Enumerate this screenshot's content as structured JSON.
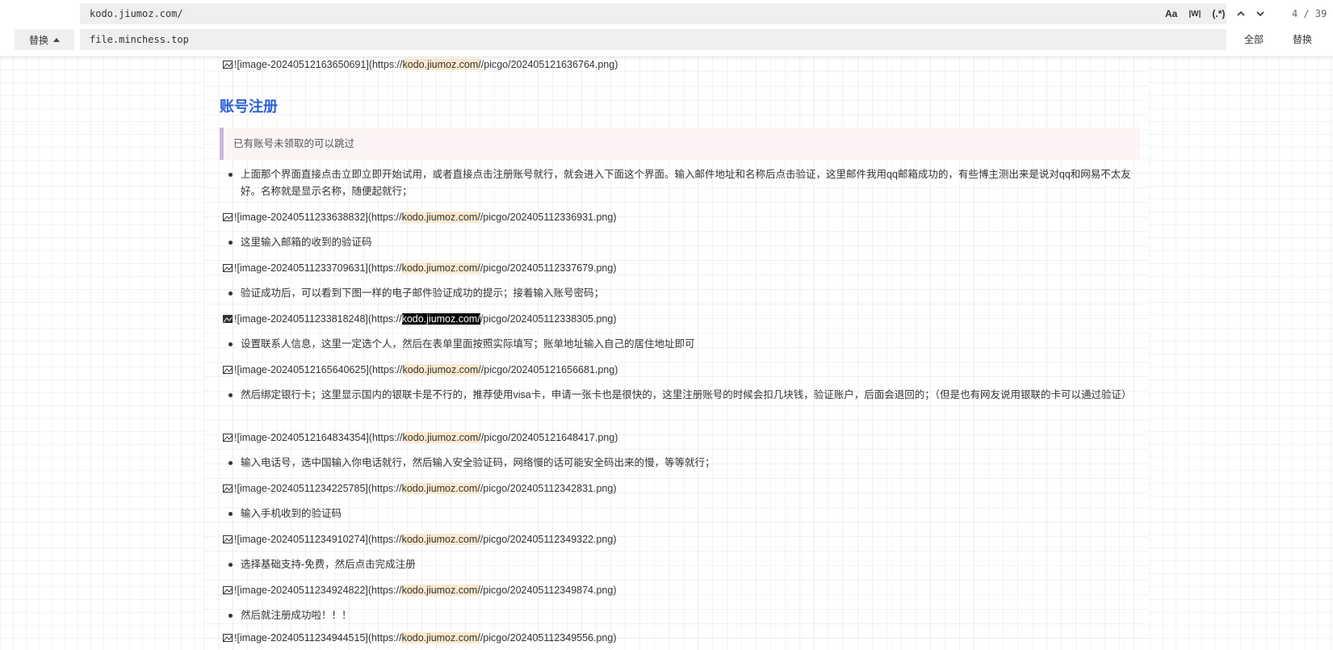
{
  "find": {
    "query": "kodo.jiumoz.com/",
    "option_case": "Aa",
    "option_word": "|W|",
    "option_regex": "(.*)",
    "match_count": "4 / 39"
  },
  "replace": {
    "toggle_label": "替换",
    "value": "file.minchess.top",
    "replace_all_label": "全部",
    "replace_label": "替换"
  },
  "document": {
    "img0": {
      "prefix": "![image-20240512163650691](https://",
      "match": "kodo.jiumoz.com/",
      "suffix": "/picgo/202405121636764.png)"
    },
    "heading": "账号注册",
    "quote": "已有账号未领取的可以跳过",
    "b1": "上面那个界面直接点击立即立即开始试用，或者直接点击注册账号就行，就会进入下面这个界面。输入邮件地址和名称后点击验证，这里邮件我用qq邮箱成功的，有些博主测出来是说对qq和网易不太友好。名称就是显示名称，随便起就行；",
    "img1": {
      "prefix": "![image-20240511233638832](https://",
      "match": "kodo.jiumoz.com/",
      "suffix": "/picgo/202405112336931.png)"
    },
    "b2": "这里输入邮箱的收到的验证码",
    "img2": {
      "prefix": "![image-20240511233709631](https://",
      "match": "kodo.jiumoz.com/",
      "suffix": "/picgo/202405112337679.png)"
    },
    "b3": "验证成功后，可以看到下图一样的电子邮件验证成功的提示；接着输入账号密码；",
    "img3": {
      "prefix": "![image-20240511233818248](https://",
      "match": "kodo.jiumoz.com/",
      "suffix": "/picgo/202405112338305.png)"
    },
    "b4": "设置联系人信息，这里一定选个人，然后在表单里面按照实际填写；账单地址输入自己的居住地址即可",
    "img4": {
      "prefix": "![image-20240512165640625](https://",
      "match": "kodo.jiumoz.com/",
      "suffix": "/picgo/202405121656681.png)"
    },
    "b5": "然后绑定银行卡；这里显示国内的银联卡是不行的，推荐使用visa卡，申请一张卡也是很快的，这里注册账号的时候会扣几块钱，验证账户，后面会退回的；（但是也有网友说用银联的卡可以通过验证）",
    "img5": {
      "prefix": "![image-20240512164834354](https://",
      "match": "kodo.jiumoz.com/",
      "suffix": "/picgo/202405121648417.png)"
    },
    "b6": "输入电话号，选中国输入你电话就行，然后输入安全验证码，网络慢的话可能安全码出来的慢，等等就行；",
    "img6": {
      "prefix": "![image-20240511234225785](https://",
      "match": "kodo.jiumoz.com/",
      "suffix": "/picgo/202405112342831.png)"
    },
    "b7": "输入手机收到的验证码",
    "img7": {
      "prefix": "![image-20240511234910274](https://",
      "match": "kodo.jiumoz.com/",
      "suffix": "/picgo/202405112349322.png)"
    },
    "b8": "选择基础支持-免费，然后点击完成注册",
    "img8": {
      "prefix": "![image-20240511234924822](https://",
      "match": "kodo.jiumoz.com/",
      "suffix": "/picgo/202405112349874.png)"
    },
    "b9": "然后就注册成功啦！！！",
    "img9": {
      "prefix": "![image-20240511234944515](https://",
      "match": "kodo.jiumoz.com/",
      "suffix": "/picgo/202405112349556.png)"
    }
  },
  "colors": {
    "heading": "#2c5fd6",
    "match_highlight": "#fbe9cf",
    "active_match": "#000000"
  },
  "icons": [
    "broken-image-icon",
    "chevron-up-icon",
    "chevron-down-icon",
    "caret-up-icon"
  ]
}
